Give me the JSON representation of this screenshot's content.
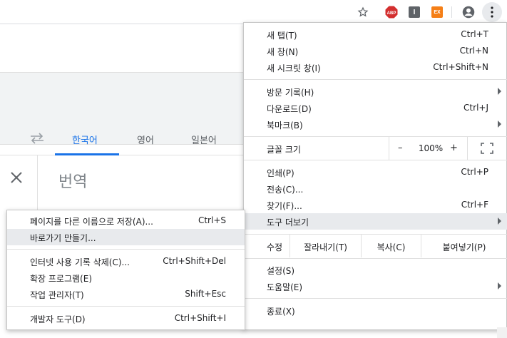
{
  "colors": {
    "accent": "#1a73e8",
    "highlight": "#e8eaed",
    "abp_red": "#d32f2f",
    "ext_orange": "#f57f17"
  },
  "toolbar": {
    "bookmark_icon": "star-icon",
    "ext_abp_label": "ABP",
    "ext_2_label": "I",
    "ext_3_label": "EX",
    "profile_icon": "account-circle-icon",
    "menu_icon": "kebab-menu-icon"
  },
  "translate_page": {
    "tabs": [
      {
        "label": "한국어",
        "active": true
      },
      {
        "label": "영어",
        "active": false
      },
      {
        "label": "일본어",
        "active": false
      }
    ],
    "swap_icon": "swap-arrows-icon",
    "close_icon": "close-icon",
    "source_text": "번역"
  },
  "main_menu": {
    "new_tab": {
      "label": "새 탭(T)",
      "shortcut": "Ctrl+T"
    },
    "new_window": {
      "label": "새 창(N)",
      "shortcut": "Ctrl+N"
    },
    "new_incognito": {
      "label": "새 시크릿 창(I)",
      "shortcut": "Ctrl+Shift+N"
    },
    "history": {
      "label": "방문 기록(H)"
    },
    "downloads": {
      "label": "다운로드(D)",
      "shortcut": "Ctrl+J"
    },
    "bookmarks": {
      "label": "북마크(B)"
    },
    "zoom": {
      "label": "글꼴 크기",
      "minus": "–",
      "value": "100%",
      "plus": "+"
    },
    "print": {
      "label": "인쇄(P)",
      "shortcut": "Ctrl+P"
    },
    "cast": {
      "label": "전송(C)..."
    },
    "find": {
      "label": "찾기(F)...",
      "shortcut": "Ctrl+F"
    },
    "more_tools": {
      "label": "도구 더보기"
    },
    "edit": {
      "label": "수정",
      "cut": "잘라내기(T)",
      "copy": "복사(C)",
      "paste": "붙여넣기(P)"
    },
    "settings": {
      "label": "설정(S)"
    },
    "help": {
      "label": "도움말(E)"
    },
    "exit": {
      "label": "종료(X)"
    }
  },
  "sub_menu": {
    "save_page": {
      "label": "페이지를 다른 이름으로 저장(A)...",
      "shortcut": "Ctrl+S"
    },
    "create_shortcut": {
      "label": "바로가기 만들기..."
    },
    "clear_data": {
      "label": "인터넷 사용 기록 삭제(C)...",
      "shortcut": "Ctrl+Shift+Del"
    },
    "extensions": {
      "label": "확장 프로그램(E)"
    },
    "task_manager": {
      "label": "작업 관리자(T)",
      "shortcut": "Shift+Esc"
    },
    "dev_tools": {
      "label": "개발자 도구(D)",
      "shortcut": "Ctrl+Shift+I"
    }
  }
}
